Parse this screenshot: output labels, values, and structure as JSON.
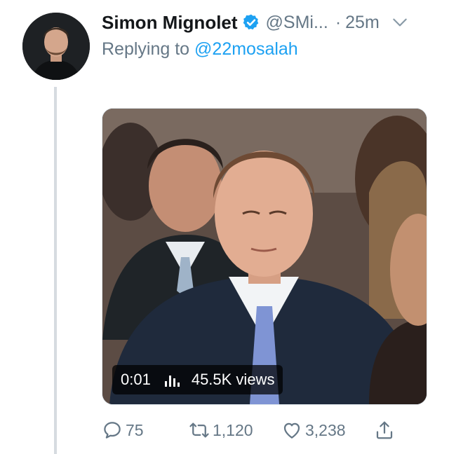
{
  "tweet": {
    "author_name": "Simon Mignolet",
    "author_handle": "@SMi...",
    "separator": "·",
    "time": "25m",
    "replying_prefix": "Replying to",
    "replying_to": "@22mosalah"
  },
  "media": {
    "duration": "0:01",
    "views": "45.5K views"
  },
  "actions": {
    "replies": "75",
    "retweets": "1,120",
    "likes": "3,238"
  },
  "colors": {
    "accent": "#1da1f2",
    "secondary_text": "#657786",
    "primary_text": "#14171a",
    "thread_line": "#d6dbe0"
  },
  "icons": {
    "verified": "verified-badge-icon",
    "chevron": "chevron-down-icon",
    "reply": "reply-icon",
    "retweet": "retweet-icon",
    "like": "heart-icon",
    "share": "share-icon",
    "stats": "stats-bars-icon"
  }
}
